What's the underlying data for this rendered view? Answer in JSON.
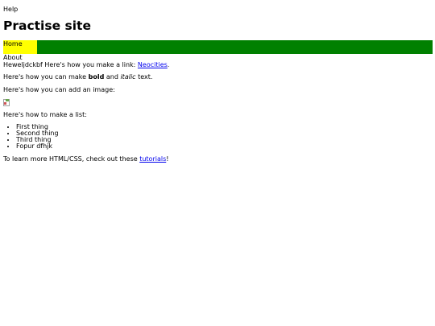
{
  "top_link": "Help",
  "title": "Practise site",
  "nav": {
    "home": "Home",
    "about": "About"
  },
  "content": {
    "p1_before": "Heweljdckbf Here's how you make a link: ",
    "p1_link": "Neocities",
    "p1_after": ".",
    "p2_before": "Here's how you can make ",
    "p2_bold": "bold",
    "p2_middle": " and ",
    "p2_italic": "italic",
    "p2_after": " text.",
    "p3": "Here's how you can add an image:",
    "p4": "Here's how to make a list:",
    "list": [
      "First thing",
      "Second thing",
      "Third thing",
      "Fopur dfhjk"
    ],
    "p5_before": "To learn more HTML/CSS, check out these ",
    "p5_link": "tutorials",
    "p5_after": "!"
  },
  "colors": {
    "navbar_bg": "#008000",
    "home_bg": "#ffff00",
    "link": "#0000ee"
  },
  "icons": {
    "broken_image": "broken-image-icon"
  }
}
